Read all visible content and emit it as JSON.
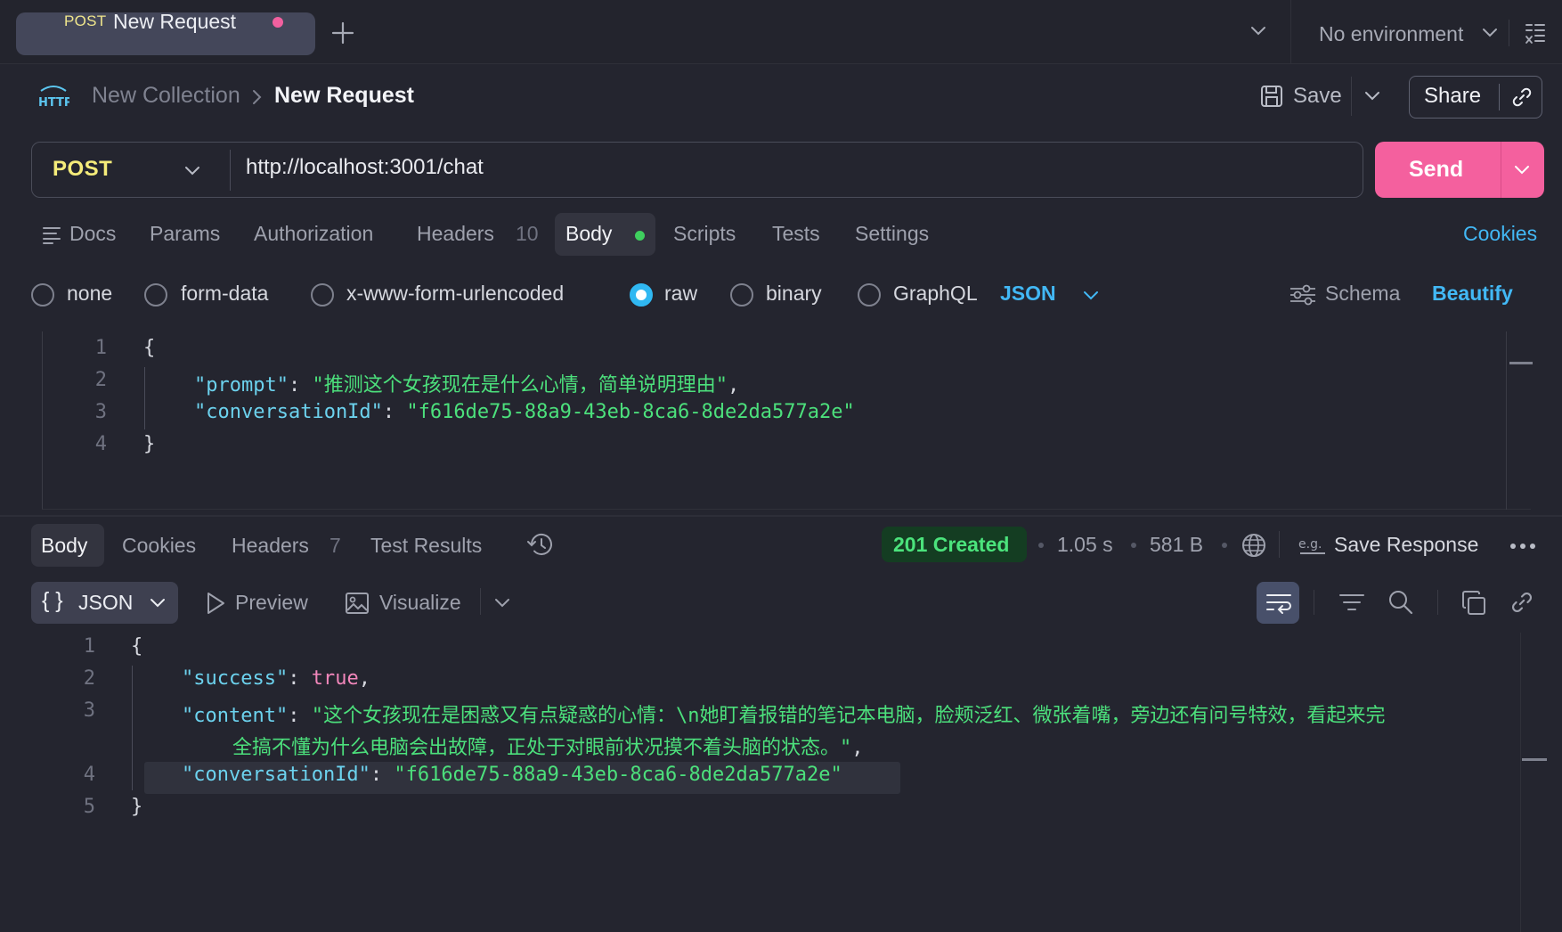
{
  "tabbar": {
    "tab_method": "POST",
    "tab_name": "New Request",
    "environment": "No environment",
    "colors": {
      "unsaved_dot": "#f2609f",
      "tab_bg": "#44475a"
    }
  },
  "header": {
    "breadcrumb_collection": "New Collection",
    "breadcrumb_request": "New Request",
    "save_label": "Save",
    "share_label": "Share",
    "http_icon": "http-icon"
  },
  "urlbar": {
    "method": "POST",
    "url": "http://localhost:3001/chat",
    "send_label": "Send",
    "colors": {
      "send": "#f4609e",
      "method": "#f5ec7a"
    }
  },
  "request_tabs": {
    "docs": "Docs",
    "params": "Params",
    "authorization": "Authorization",
    "headers": "Headers",
    "headers_count": "10",
    "body": "Body",
    "scripts": "Scripts",
    "tests": "Tests",
    "settings": "Settings",
    "cookies": "Cookies",
    "active": "Body"
  },
  "body_types": {
    "options": [
      "none",
      "form-data",
      "x-www-form-urlencoded",
      "raw",
      "binary",
      "GraphQL"
    ],
    "selected": "raw",
    "format": "JSON",
    "schema": "Schema",
    "beautify": "Beautify"
  },
  "request_body": {
    "line_numbers": [
      "1",
      "2",
      "3",
      "4"
    ],
    "open_brace": "{",
    "close_brace": "}",
    "prompt_key": "\"prompt\"",
    "prompt_value": "\"推测这个女孩现在是什么心情，简单说明理由\"",
    "conv_key": "\"conversationId\"",
    "conv_value": "\"f616de75-88a9-43eb-8ca6-8de2da577a2e\"",
    "colon": ": ",
    "comma": ","
  },
  "response_tabs": {
    "body": "Body",
    "cookies": "Cookies",
    "headers": "Headers",
    "headers_count": "7",
    "test_results": "Test Results",
    "status": "201 Created",
    "time": "1.05 s",
    "size": "581 B",
    "save_response": "Save Response",
    "colors": {
      "status_bg": "#143d22",
      "status_text": "#4be37c"
    }
  },
  "response_toolbar": {
    "format": "JSON",
    "braces": "{ }",
    "preview": "Preview",
    "visualize": "Visualize"
  },
  "response_body": {
    "line_numbers": [
      "1",
      "2",
      "3",
      "4",
      "5"
    ],
    "open_brace": "{",
    "close_brace": "}",
    "success_key": "\"success\"",
    "success_value": "true",
    "content_key": "\"content\"",
    "content_value_line1": "\"这个女孩现在是困惑又有点疑惑的心情：\\n她盯着报错的笔记本电脑，脸颊泛红、微张着嘴，旁边还有问号特效，看起来完",
    "content_value_line2": "全搞不懂为什么电脑会出故障，正处于对眼前状况摸不着头脑的状态。\"",
    "conv_key": "\"conversationId\"",
    "conv_value": "\"f616de75-88a9-43eb-8ca6-8de2da577a2e\"",
    "colon": ": ",
    "comma": ","
  }
}
